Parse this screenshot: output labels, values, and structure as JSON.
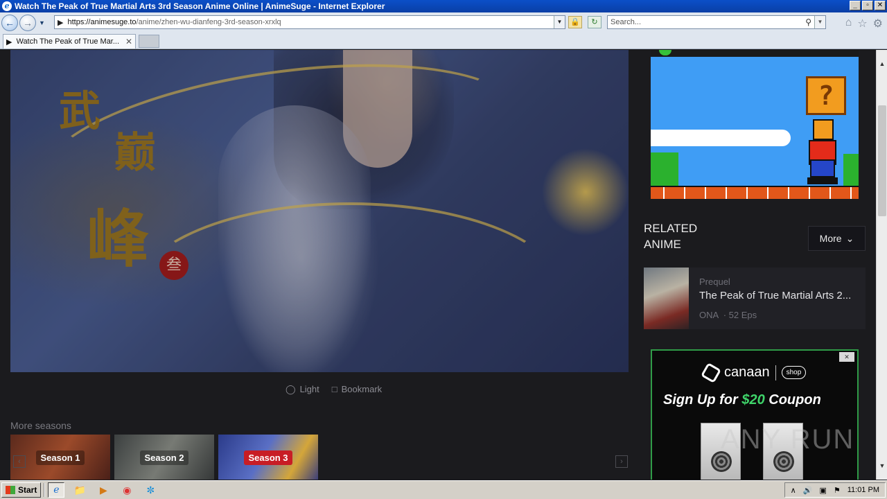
{
  "window": {
    "title": "Watch The Peak of True Martial Arts 3rd Season Anime Online | AnimeSuge - Internet Explorer",
    "controls": [
      "_",
      "▫",
      "✕"
    ]
  },
  "navbar": {
    "url_host": "https://animesuge.to",
    "url_path": "/anime/zhen-wu-dianfeng-3rd-season-xrxlq",
    "search_placeholder": "Search..."
  },
  "tabs": [
    {
      "label": "Watch The Peak of True Mar...",
      "close": "✕"
    }
  ],
  "page": {
    "hero_calligraphy": [
      "武",
      "巅",
      "峰"
    ],
    "hero_seal": "叁",
    "actions": {
      "light": "Light",
      "bookmark": "Bookmark"
    },
    "more_seasons_title": "More seasons",
    "seasons": [
      {
        "label": "Season 1"
      },
      {
        "label": "Season 2"
      },
      {
        "label": "Season 3",
        "active": true
      }
    ],
    "related": {
      "heading_line1": "RELATED",
      "heading_line2": "ANIME",
      "more_label": "More",
      "items": [
        {
          "relation": "Prequel",
          "title": "The Peak of True Martial Arts 2...",
          "type": "ONA",
          "episodes": "52 Eps"
        }
      ]
    },
    "ad_canaan": {
      "brand": "canaan",
      "shop": "shop",
      "headline_pre": "Sign Up for ",
      "headline_amount": "$20",
      "headline_post": " Coupon"
    },
    "watermark": "ANY RUN"
  },
  "taskbar": {
    "start_label": "Start",
    "clock": "11:01 PM"
  },
  "colors": {
    "page_bg": "#1b1b1e",
    "season_active": "#c81d25",
    "ad_green": "#3fd46a"
  }
}
